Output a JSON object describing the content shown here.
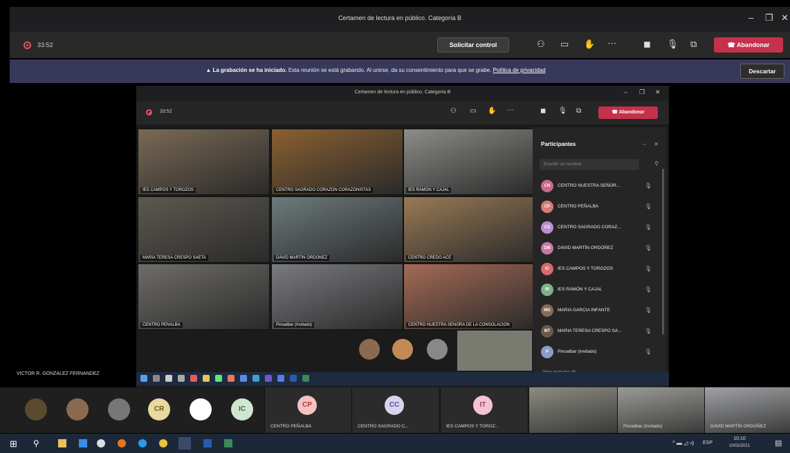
{
  "outer": {
    "title": "Certamen de lectura en público. Categoría B",
    "timer": "33:52",
    "control_button": "Solicitar control",
    "leave_button": "Abandonar",
    "win_min": "–",
    "win_max": "❐",
    "win_close": "✕"
  },
  "banner": {
    "bold": "La grabación se ha iniciado.",
    "text": " Esta reunión se está grabando. Al unirse, da su consentimiento para que se grabe. ",
    "link": "Política de privacidad",
    "dismiss": "Descartar"
  },
  "inner": {
    "title": "Certamen de lectura en público. Categoría B",
    "timer": "33:52",
    "leave_button": "Abandonar"
  },
  "tiles": [
    {
      "label": "IES CAMPOS Y TOROZOS",
      "color": "#7a6a55"
    },
    {
      "label": "CENTRO SAGRADO CORAZÓN CORAZONISTAS",
      "color": "#8a6030"
    },
    {
      "label": "IES RAMÓN Y CAJAL",
      "color": "#8c8c88"
    },
    {
      "label": "MARÍA TERESA CRESPO SAETA",
      "color": "#5d5950"
    },
    {
      "label": "DAVID MARTÍN ORDÓÑEZ",
      "color": "#6d7a7c"
    },
    {
      "label": "CENTRO CREDO ACE",
      "color": "#9a7a55"
    },
    {
      "label": "CENTRO PEÑALBA",
      "color": "#6f6d68"
    },
    {
      "label": "Pinoalbar (Invitado)",
      "color": "#7a7b7f"
    },
    {
      "label": "CENTRO NUESTRA SEÑORA DE LA CONSOLACIÓN",
      "color": "#a56a55"
    }
  ],
  "panel": {
    "title": "Participantes",
    "search_placeholder": "Escribir un nombre",
    "participants": [
      {
        "name": "CENTRO NUESTRA SEÑOR...",
        "initials": "CN",
        "color": "#c96a8a"
      },
      {
        "name": "CENTRO PEÑALBA",
        "initials": "CP",
        "color": "#d77a7a"
      },
      {
        "name": "CENTRO SAGRADO CORAZ...",
        "initials": "CS",
        "color": "#b98fce"
      },
      {
        "name": "DAVID MARTÍN ORDÓÑEZ",
        "initials": "DM",
        "color": "#c57aa5"
      },
      {
        "name": "IES CAMPOS Y TOROZOS",
        "initials": "IC",
        "color": "#d56b6b"
      },
      {
        "name": "IES RAMÓN Y CAJAL",
        "initials": "IR",
        "color": "#7fb08a"
      },
      {
        "name": "MARIA GARCIA INFANTE",
        "initials": "MG",
        "color": "#8a6a50"
      },
      {
        "name": "MARIA TERESA CRESPO SA...",
        "initials": "MT",
        "color": "#6a5a4a"
      },
      {
        "name": "Pinoalbar (Invitado)",
        "initials": "P",
        "color": "#8a9cc9"
      }
    ],
    "more_label": "Otros invitados (5)"
  },
  "name_label": "VICTOR R. GONZALEZ FERNANDEZ",
  "strip": {
    "avatars": [
      {
        "initials": "",
        "color": "#5a4a30"
      },
      {
        "initials": "",
        "color": "#8a6a50"
      },
      {
        "initials": "",
        "color": "#777"
      },
      {
        "initials": "CR",
        "color": "#e9d9a0",
        "fg": "#6a5a20"
      },
      {
        "initials": "",
        "color": "#ffffff",
        "fg": "#c33"
      },
      {
        "initials": "IC",
        "color": "#cfe6cf",
        "fg": "#3a6a3a"
      }
    ],
    "tiles": [
      {
        "initials": "CP",
        "name": "CENTRO PEÑALBA",
        "color": "#f3c3c3",
        "fg": "#b03a3a"
      },
      {
        "initials": "CC",
        "name": "CENTRO SAGRADO C...",
        "color": "#d9d4ee",
        "fg": "#5a4a9a"
      },
      {
        "initials": "IT",
        "name": "IES CAMPOS Y TOROZ...",
        "color": "#f3c3d3",
        "fg": "#a03a5a"
      }
    ],
    "video_labels": [
      "Pinoalbar (Invitado)",
      "DAVID MARTÍN ORDÓÑEZ"
    ]
  },
  "taskbar": {
    "lang": "ESP",
    "time": "10:10",
    "date": "10/02/2021"
  }
}
